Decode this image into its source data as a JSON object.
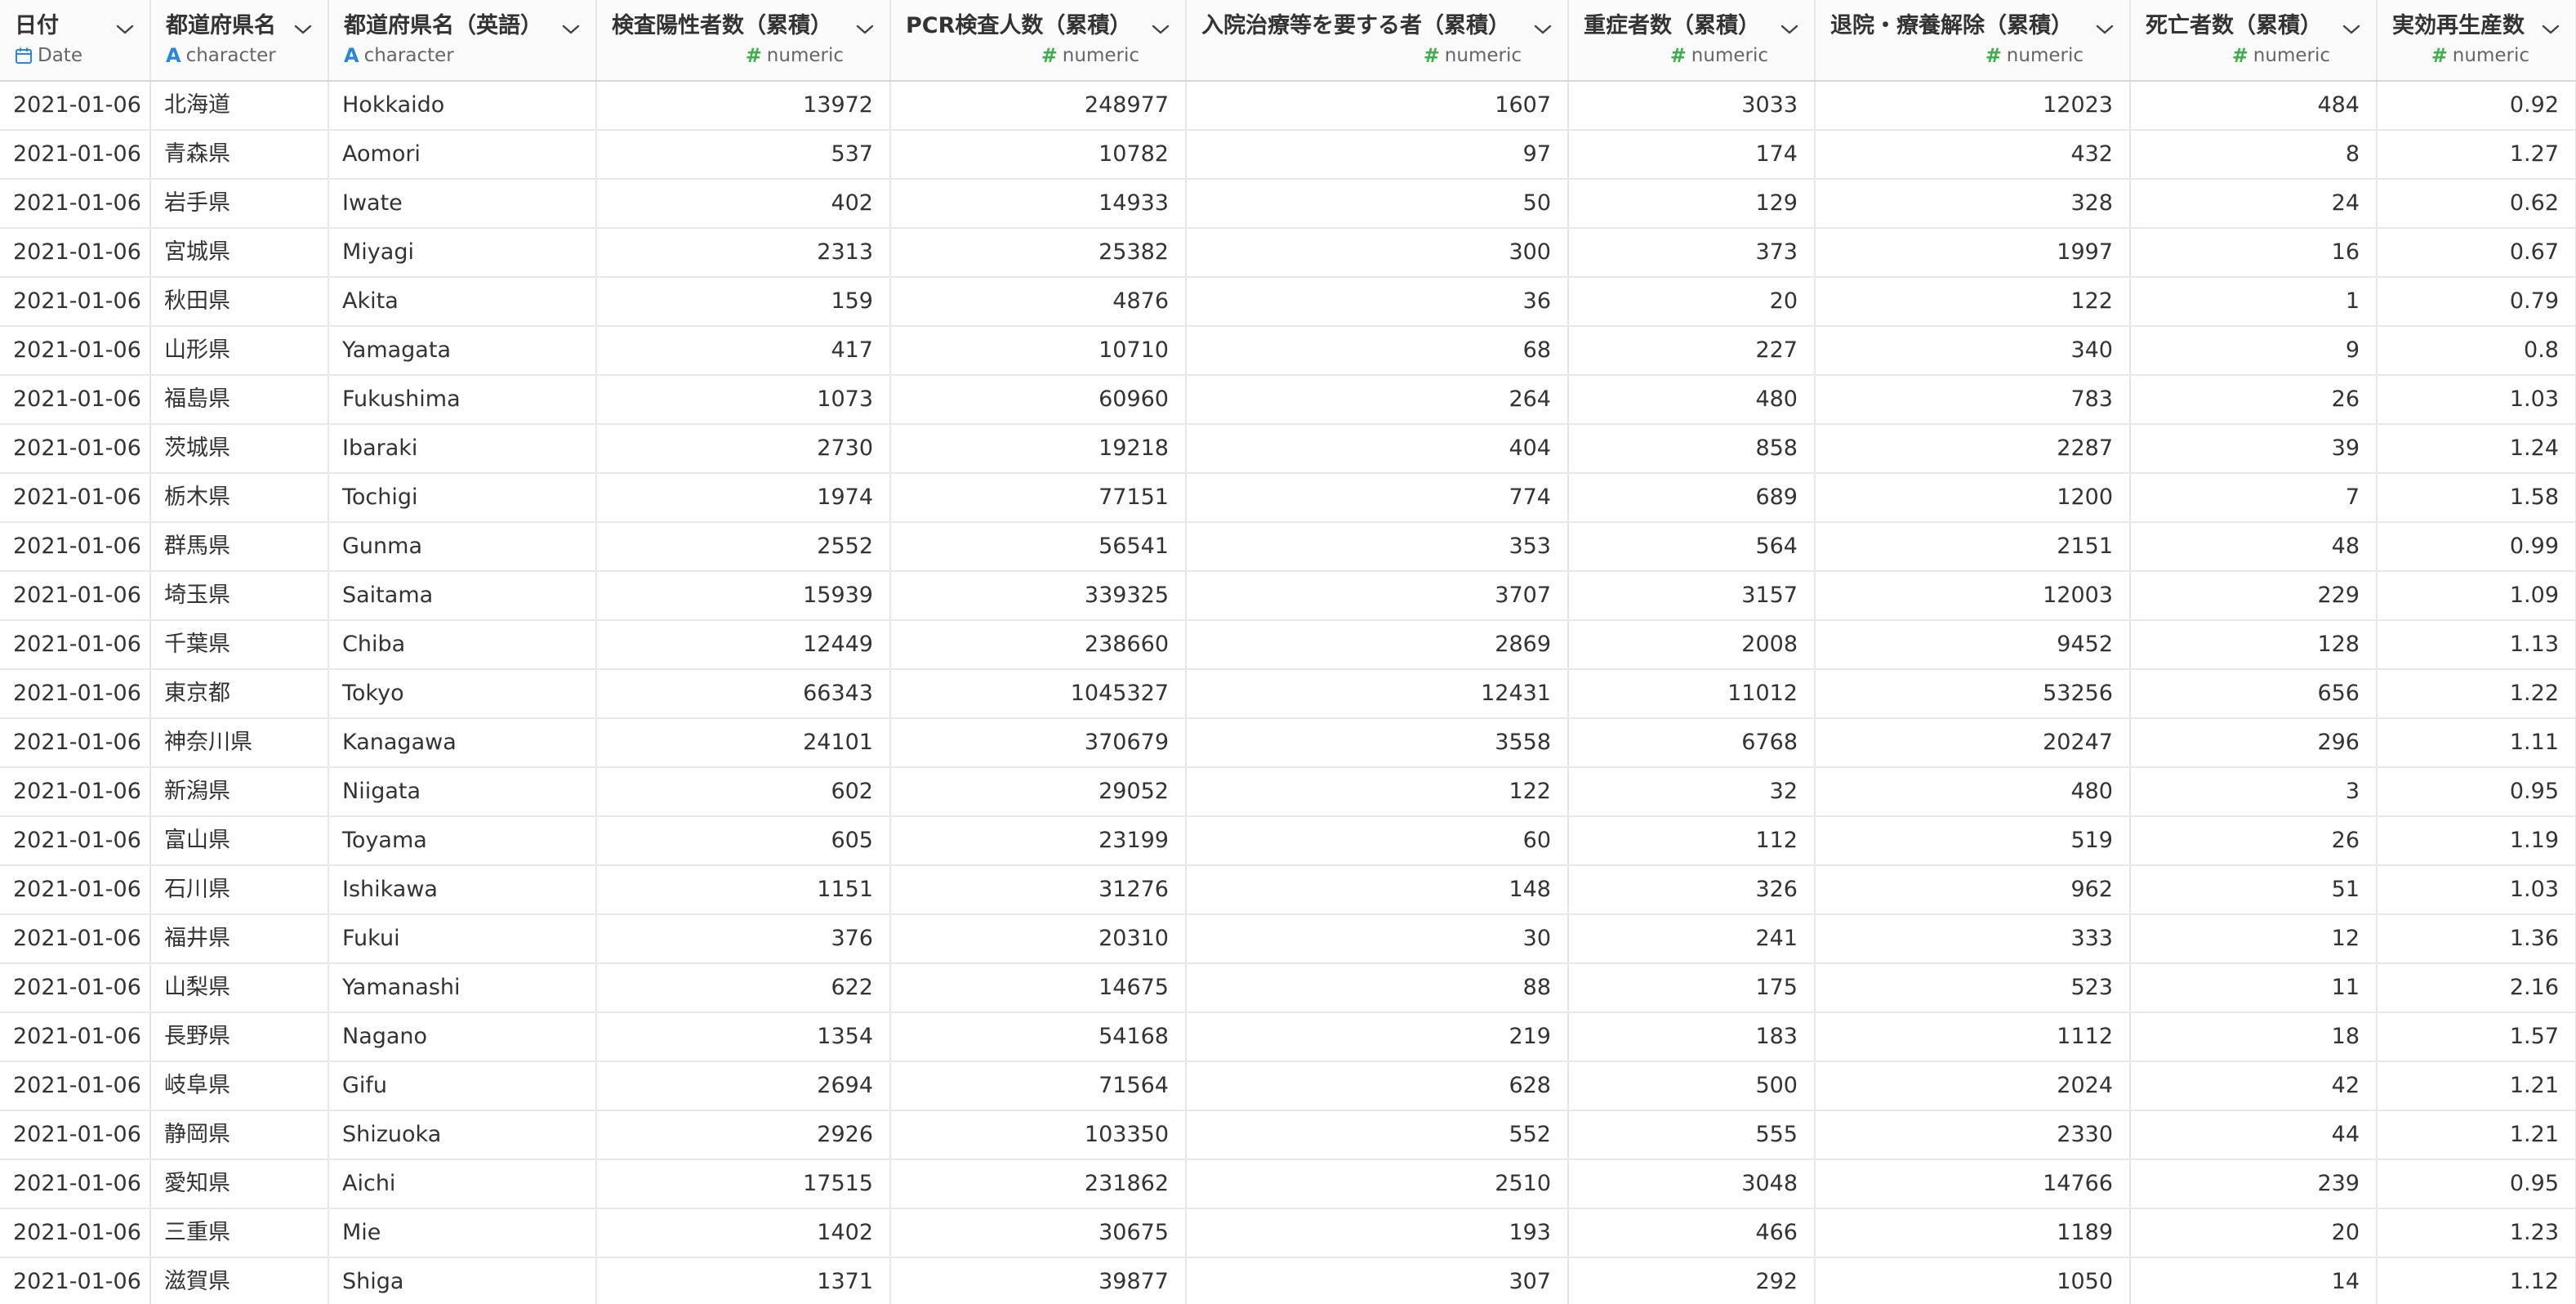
{
  "columns": [
    {
      "name": "日付",
      "type": "Date",
      "icon": "calendar-icon",
      "align": "left"
    },
    {
      "name": "都道府県名",
      "type": "character",
      "icon": "character-type-icon",
      "align": "left"
    },
    {
      "name": "都道府県名（英語）",
      "type": "character",
      "icon": "character-type-icon",
      "align": "left"
    },
    {
      "name": "検査陽性者数（累積）",
      "type": "numeric",
      "icon": "numeric-type-icon",
      "align": "right"
    },
    {
      "name": "PCR検査人数（累積）",
      "type": "numeric",
      "icon": "numeric-type-icon",
      "align": "right"
    },
    {
      "name": "入院治療等を要する者（累積）",
      "type": "numeric",
      "icon": "numeric-type-icon",
      "align": "right"
    },
    {
      "name": "重症者数（累積）",
      "type": "numeric",
      "icon": "numeric-type-icon",
      "align": "right"
    },
    {
      "name": "退院・療養解除（累積）",
      "type": "numeric",
      "icon": "numeric-type-icon",
      "align": "right"
    },
    {
      "name": "死亡者数（累積）",
      "type": "numeric",
      "icon": "numeric-type-icon",
      "align": "right"
    },
    {
      "name": "実効再生産数",
      "type": "numeric",
      "icon": "numeric-type-icon",
      "align": "right"
    }
  ],
  "rows": [
    [
      "2021-01-06",
      "北海道",
      "Hokkaido",
      "13972",
      "248977",
      "1607",
      "3033",
      "12023",
      "484",
      "0.92"
    ],
    [
      "2021-01-06",
      "青森県",
      "Aomori",
      "537",
      "10782",
      "97",
      "174",
      "432",
      "8",
      "1.27"
    ],
    [
      "2021-01-06",
      "岩手県",
      "Iwate",
      "402",
      "14933",
      "50",
      "129",
      "328",
      "24",
      "0.62"
    ],
    [
      "2021-01-06",
      "宮城県",
      "Miyagi",
      "2313",
      "25382",
      "300",
      "373",
      "1997",
      "16",
      "0.67"
    ],
    [
      "2021-01-06",
      "秋田県",
      "Akita",
      "159",
      "4876",
      "36",
      "20",
      "122",
      "1",
      "0.79"
    ],
    [
      "2021-01-06",
      "山形県",
      "Yamagata",
      "417",
      "10710",
      "68",
      "227",
      "340",
      "9",
      "0.8"
    ],
    [
      "2021-01-06",
      "福島県",
      "Fukushima",
      "1073",
      "60960",
      "264",
      "480",
      "783",
      "26",
      "1.03"
    ],
    [
      "2021-01-06",
      "茨城県",
      "Ibaraki",
      "2730",
      "19218",
      "404",
      "858",
      "2287",
      "39",
      "1.24"
    ],
    [
      "2021-01-06",
      "栃木県",
      "Tochigi",
      "1974",
      "77151",
      "774",
      "689",
      "1200",
      "7",
      "1.58"
    ],
    [
      "2021-01-06",
      "群馬県",
      "Gunma",
      "2552",
      "56541",
      "353",
      "564",
      "2151",
      "48",
      "0.99"
    ],
    [
      "2021-01-06",
      "埼玉県",
      "Saitama",
      "15939",
      "339325",
      "3707",
      "3157",
      "12003",
      "229",
      "1.09"
    ],
    [
      "2021-01-06",
      "千葉県",
      "Chiba",
      "12449",
      "238660",
      "2869",
      "2008",
      "9452",
      "128",
      "1.13"
    ],
    [
      "2021-01-06",
      "東京都",
      "Tokyo",
      "66343",
      "1045327",
      "12431",
      "11012",
      "53256",
      "656",
      "1.22"
    ],
    [
      "2021-01-06",
      "神奈川県",
      "Kanagawa",
      "24101",
      "370679",
      "3558",
      "6768",
      "20247",
      "296",
      "1.11"
    ],
    [
      "2021-01-06",
      "新潟県",
      "Niigata",
      "602",
      "29052",
      "122",
      "32",
      "480",
      "3",
      "0.95"
    ],
    [
      "2021-01-06",
      "富山県",
      "Toyama",
      "605",
      "23199",
      "60",
      "112",
      "519",
      "26",
      "1.19"
    ],
    [
      "2021-01-06",
      "石川県",
      "Ishikawa",
      "1151",
      "31276",
      "148",
      "326",
      "962",
      "51",
      "1.03"
    ],
    [
      "2021-01-06",
      "福井県",
      "Fukui",
      "376",
      "20310",
      "30",
      "241",
      "333",
      "12",
      "1.36"
    ],
    [
      "2021-01-06",
      "山梨県",
      "Yamanashi",
      "622",
      "14675",
      "88",
      "175",
      "523",
      "11",
      "2.16"
    ],
    [
      "2021-01-06",
      "長野県",
      "Nagano",
      "1354",
      "54168",
      "219",
      "183",
      "1112",
      "18",
      "1.57"
    ],
    [
      "2021-01-06",
      "岐阜県",
      "Gifu",
      "2694",
      "71564",
      "628",
      "500",
      "2024",
      "42",
      "1.21"
    ],
    [
      "2021-01-06",
      "静岡県",
      "Shizuoka",
      "2926",
      "103350",
      "552",
      "555",
      "2330",
      "44",
      "1.21"
    ],
    [
      "2021-01-06",
      "愛知県",
      "Aichi",
      "17515",
      "231862",
      "2510",
      "3048",
      "14766",
      "239",
      "0.95"
    ],
    [
      "2021-01-06",
      "三重県",
      "Mie",
      "1402",
      "30675",
      "193",
      "466",
      "1189",
      "20",
      "1.23"
    ],
    [
      "2021-01-06",
      "滋賀県",
      "Shiga",
      "1371",
      "39877",
      "307",
      "292",
      "1050",
      "14",
      "1.12"
    ]
  ]
}
